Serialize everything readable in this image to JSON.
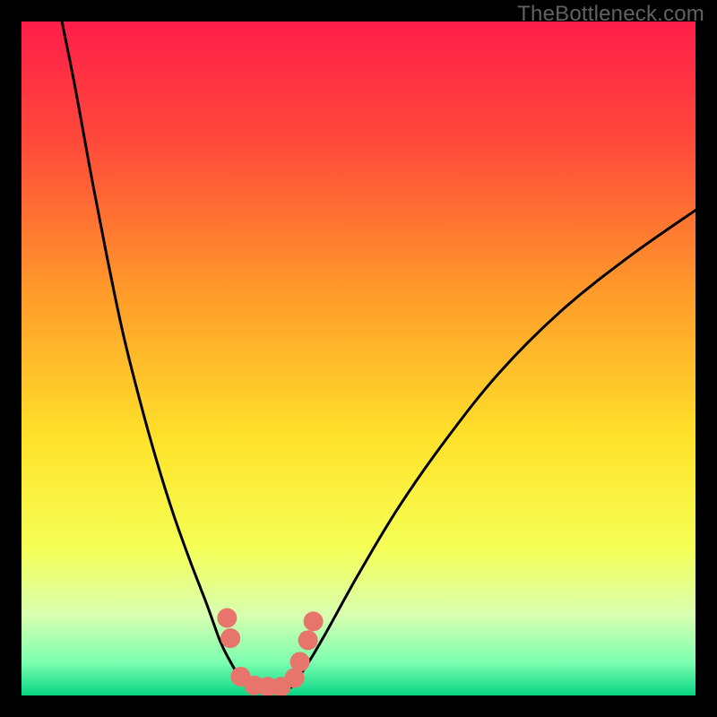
{
  "watermark": "TheBottleneck.com",
  "chart_data": {
    "type": "line",
    "title": "",
    "xlabel": "",
    "ylabel": "",
    "xlim": [
      0,
      100
    ],
    "ylim": [
      0,
      100
    ],
    "grid": false,
    "background_gradient": {
      "stops": [
        {
          "offset": 0.0,
          "color": "#ff1e4a"
        },
        {
          "offset": 0.18,
          "color": "#ff4a3a"
        },
        {
          "offset": 0.4,
          "color": "#ff9a2a"
        },
        {
          "offset": 0.62,
          "color": "#ffe22a"
        },
        {
          "offset": 0.78,
          "color": "#f5ff55"
        },
        {
          "offset": 0.88,
          "color": "#d9ffb0"
        },
        {
          "offset": 0.95,
          "color": "#7dffb0"
        },
        {
          "offset": 1.0,
          "color": "#07d683"
        }
      ]
    },
    "series": [
      {
        "name": "left-curve",
        "x": [
          6.0,
          8.0,
          10.0,
          12.5,
          15.0,
          17.5,
          20.0,
          22.5,
          25.0,
          27.5,
          29.5,
          31.0,
          32.5,
          33.5
        ],
        "y": [
          100.0,
          90.0,
          79.0,
          66.0,
          54.0,
          44.0,
          35.0,
          27.0,
          20.0,
          13.5,
          8.0,
          5.0,
          2.5,
          1.5
        ]
      },
      {
        "name": "right-curve",
        "x": [
          40.0,
          42.0,
          45.0,
          50.0,
          56.0,
          63.0,
          71.0,
          80.0,
          90.0,
          100.0
        ],
        "y": [
          1.5,
          4.0,
          9.0,
          18.0,
          28.0,
          38.0,
          48.0,
          57.0,
          65.0,
          72.0
        ]
      }
    ],
    "floor_band": {
      "x": [
        33.5,
        40.0
      ],
      "y": 1.2
    },
    "markers": {
      "name": "marker-dots",
      "color": "#e8756c",
      "radius": 11,
      "points": [
        {
          "x": 30.5,
          "y": 11.5
        },
        {
          "x": 31.0,
          "y": 8.5
        },
        {
          "x": 32.5,
          "y": 2.8
        },
        {
          "x": 34.5,
          "y": 1.5
        },
        {
          "x": 36.5,
          "y": 1.3
        },
        {
          "x": 38.5,
          "y": 1.3
        },
        {
          "x": 40.5,
          "y": 2.6
        },
        {
          "x": 41.3,
          "y": 5.0
        },
        {
          "x": 42.5,
          "y": 8.2
        },
        {
          "x": 43.3,
          "y": 11.0
        }
      ]
    }
  }
}
